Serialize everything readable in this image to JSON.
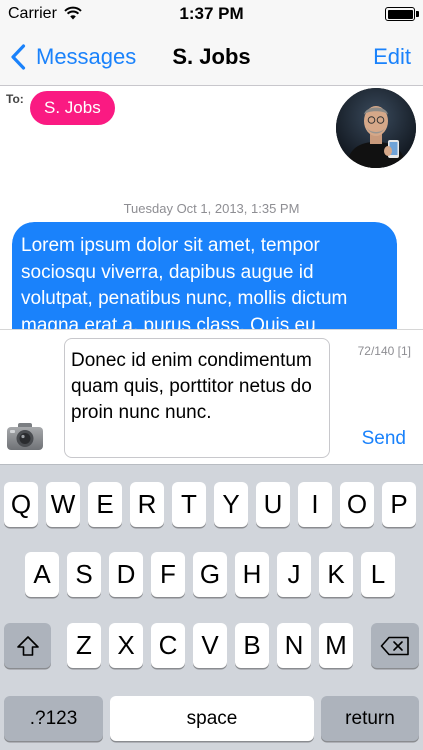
{
  "status_bar": {
    "carrier": "Carrier",
    "time": "1:37 PM",
    "wifi_icon": "wifi-icon",
    "battery_icon": "battery-icon",
    "battery_level": 1.0
  },
  "nav": {
    "back_label": "Messages",
    "back_icon": "chevron-left-icon",
    "title": "S. Jobs",
    "edit_label": "Edit"
  },
  "recipient": {
    "to_label": "To:",
    "name": "S. Jobs",
    "chip_color": "#fa1a82"
  },
  "conversation": {
    "timestamp": "Tuesday Oct 1, 2013, 1:35 PM",
    "message_text": "Lorem ipsum dolor sit amet, tempor sociosqu viverra, dapibus augue id volutpat, penatibus nunc, mollis dictum magna erat a, purus class. Quis eu",
    "bubble_color": "#1a82fb"
  },
  "composer": {
    "input_value": "Donec id enim condimentum quam quis, porttitor netus do proin nunc nunc.",
    "char_count": "72/140 [1]",
    "send_label": "Send",
    "camera_icon": "camera-icon"
  },
  "keyboard": {
    "row1": [
      "Q",
      "W",
      "E",
      "R",
      "T",
      "Y",
      "U",
      "I",
      "O",
      "P"
    ],
    "row2": [
      "A",
      "S",
      "D",
      "F",
      "G",
      "H",
      "J",
      "K",
      "L"
    ],
    "row3": [
      "Z",
      "X",
      "C",
      "V",
      "B",
      "N",
      "M"
    ],
    "shift_icon": "shift-icon",
    "delete_icon": "backspace-icon",
    "numbers_label": ".?123",
    "space_label": "space",
    "return_label": "return"
  },
  "colors": {
    "accent": "#1a82fb",
    "keyboard_bg": "#d1d5db"
  }
}
